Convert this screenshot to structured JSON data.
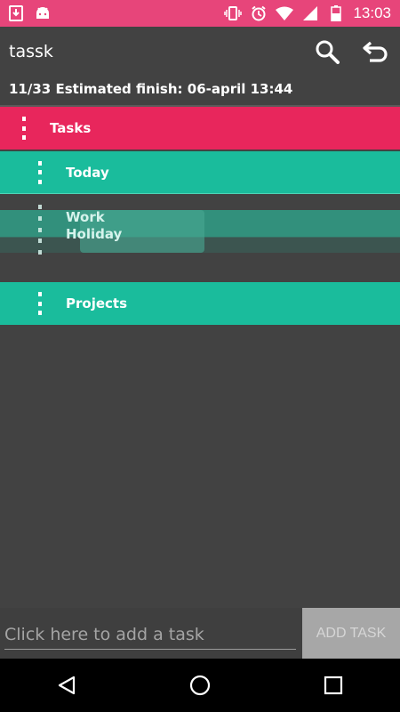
{
  "status_bar": {
    "time": "13:03",
    "icons": [
      "download-icon",
      "android-icon",
      "vibrate-icon",
      "alarm-icon",
      "wifi-icon",
      "signal-icon",
      "battery-icon"
    ]
  },
  "app_bar": {
    "title": "tassk",
    "actions": [
      "search-icon",
      "undo-icon"
    ]
  },
  "progress_text": "11/33 Estimated finish: 06-april 13:44",
  "lists": [
    {
      "label": "Tasks",
      "color": "#e8265c"
    },
    {
      "label": "Today",
      "color": "#1abc9c"
    },
    {
      "label": "Work",
      "color": "#1abc9c"
    },
    {
      "label": "Holiday",
      "color": "#1abc9c"
    },
    {
      "label": "Projects",
      "color": "#1abc9c"
    }
  ],
  "input": {
    "placeholder": "Click here to add a task",
    "value": ""
  },
  "add_button_label": "ADD TASK",
  "nav": [
    "back-icon",
    "home-icon",
    "recents-icon"
  ],
  "colors": {
    "status_bar": "#e7457a",
    "accent_pink": "#e8265c",
    "accent_teal": "#1abc9c",
    "background": "#424242"
  }
}
